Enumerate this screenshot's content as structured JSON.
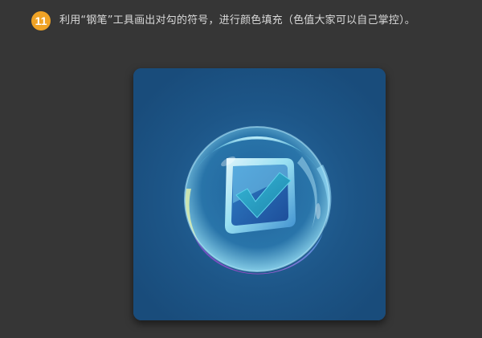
{
  "step": {
    "number": "11",
    "instruction": "利用“钢笔”工具画出对勾的符号，进行颜色填充（色值大家可以自己掌控）。"
  },
  "artwork": {
    "canvas_color": "#1c5285",
    "icon": "glass-bubble-checkmark-icon",
    "badge_color": "#f0a326",
    "check_color": "#1e8fb0"
  }
}
